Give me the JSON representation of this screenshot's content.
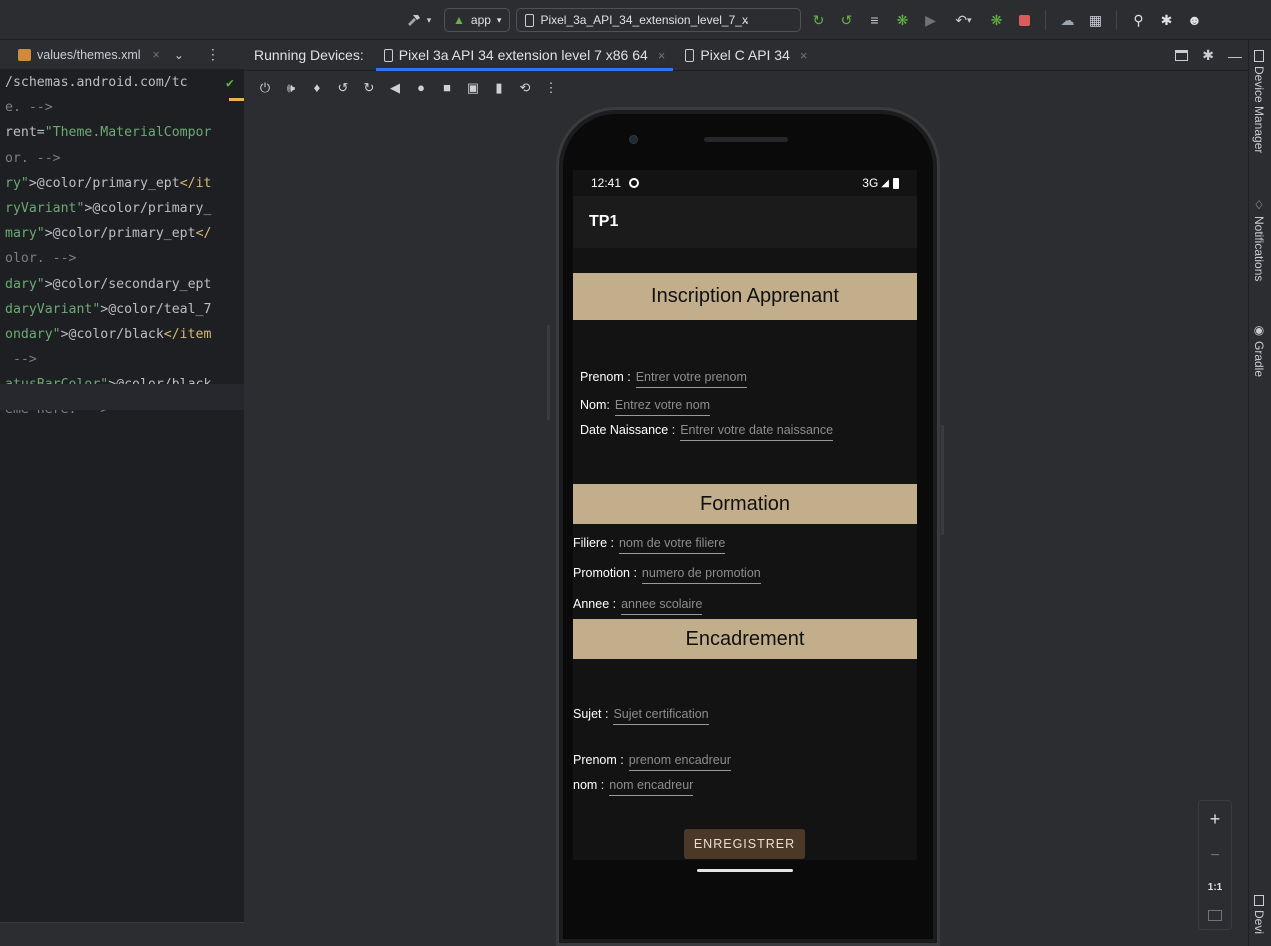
{
  "toolbar": {
    "run_config": "app",
    "device_selector": "Pixel_3a_API_34_extension_level_7_x̵",
    "icons": [
      "hammer-icon",
      "android-icon",
      "run-icon",
      "apply-changes-icon",
      "apply-code-changes-icon",
      "debug-icon",
      "profile-icon",
      "attach-debugger-icon",
      "stop-icon",
      "sync-icon",
      "device-manager-icon",
      "search-icon",
      "settings-icon",
      "account-icon"
    ]
  },
  "editor": {
    "tab_label": "values/themes.xml",
    "lines": [
      {
        "parts": [
          {
            "t": "/schemas.android.com/tc",
            "c": "c-attr"
          }
        ]
      },
      {
        "parts": [
          {
            "t": "e. -->",
            "c": "c-com"
          }
        ]
      },
      {
        "parts": [
          {
            "t": "rent=",
            "c": "c-attr"
          },
          {
            "t": "\"Theme.MaterialCompor",
            "c": "c-str"
          }
        ]
      },
      {
        "parts": [
          {
            "t": "or. -->",
            "c": "c-com"
          }
        ]
      },
      {
        "parts": [
          {
            "t": "ry\"",
            "c": "c-str"
          },
          {
            "t": ">@color/primary_ept",
            "c": "c-text"
          },
          {
            "t": "</it",
            "c": "c-tag"
          }
        ]
      },
      {
        "parts": [
          {
            "t": "ryVariant\"",
            "c": "c-str"
          },
          {
            "t": ">@color/primary_",
            "c": "c-text"
          }
        ]
      },
      {
        "parts": [
          {
            "t": "mary\"",
            "c": "c-str"
          },
          {
            "t": ">@color/primary_ept",
            "c": "c-text"
          },
          {
            "t": "</",
            "c": "c-tag"
          }
        ]
      },
      {
        "parts": [
          {
            "t": "olor. -->",
            "c": "c-com"
          }
        ]
      },
      {
        "parts": [
          {
            "t": "dary\"",
            "c": "c-str"
          },
          {
            "t": ">@color/secondary_ept",
            "c": "c-text"
          }
        ]
      },
      {
        "parts": [
          {
            "t": "daryVariant\"",
            "c": "c-str"
          },
          {
            "t": ">@color/teal_7",
            "c": "c-text"
          }
        ]
      },
      {
        "parts": [
          {
            "t": "ondary\"",
            "c": "c-str"
          },
          {
            "t": ">@color/black",
            "c": "c-text"
          },
          {
            "t": "</item",
            "c": "c-tag"
          }
        ]
      },
      {
        "parts": [
          {
            "t": " -->",
            "c": "c-com"
          }
        ]
      },
      {
        "parts": [
          {
            "t": "atusBarColor\"",
            "c": "c-str"
          },
          {
            "t": ">@color/black",
            "c": "c-text"
          }
        ]
      },
      {
        "parts": [
          {
            "t": "eme here. -->",
            "c": "c-com"
          }
        ]
      }
    ]
  },
  "running_devices": {
    "label": "Running Devices:",
    "tabs": [
      {
        "label": "Pixel 3a API 34 extension level 7 x86 64",
        "active": true
      },
      {
        "label": "Pixel C API 34",
        "active": false
      }
    ]
  },
  "device_controls": [
    "power-icon",
    "volume-up-icon",
    "volume-down-icon",
    "rotate-left-icon",
    "rotate-right-icon",
    "back-icon",
    "home-icon",
    "overview-icon",
    "screenshot-icon",
    "screen-record-icon",
    "snapshot-icon",
    "more-icon"
  ],
  "phone": {
    "status_time": "12:41",
    "status_network": "3G",
    "app_title": "TP1",
    "sections": {
      "inscription": "Inscription Apprenant",
      "formation": "Formation",
      "encadrement": "Encadrement"
    },
    "fields": {
      "prenom": {
        "label": "Prenom :",
        "hint": "Entrer votre prenom"
      },
      "nom": {
        "label": "Nom:",
        "hint": "Entrez votre nom"
      },
      "date": {
        "label": "Date Naissance :",
        "hint": "Entrer votre date naissance"
      },
      "filiere": {
        "label": "Filiere :",
        "hint": "nom de votre filiere"
      },
      "promotion": {
        "label": "Promotion :",
        "hint": "numero de promotion"
      },
      "annee": {
        "label": "Annee :",
        "hint": "annee scolaire"
      },
      "sujet": {
        "label": "Sujet :",
        "hint": "Sujet certification"
      },
      "prenom_enc": {
        "label": "Prenom :",
        "hint": "prenom encadreur"
      },
      "nom_enc": {
        "label": "nom :",
        "hint": "nom encadreur"
      }
    },
    "submit_label": "ENREGISTRER"
  },
  "side_panels": {
    "device_manager": "Device Manager",
    "notifications": "Notifications",
    "gradle": "Gradle",
    "device_explorer": "Devi"
  },
  "zoom": {
    "plus": "+",
    "minus": "−",
    "actual": "1:1"
  },
  "colors": {
    "accent": "#3574f0",
    "band": "#c2ae8a",
    "button": "#4b3826"
  }
}
